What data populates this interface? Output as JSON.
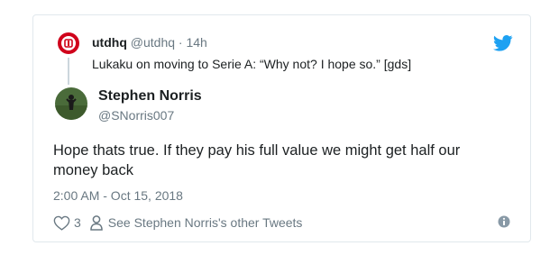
{
  "parent_tweet": {
    "name": "utdhq",
    "handle": "@utdhq",
    "separator": "·",
    "time": "14h",
    "text": "Lukaku on moving to Serie A: “Why not? I hope so.” [gds]"
  },
  "tweet": {
    "name": "Stephen Norris",
    "handle": "@SNorris007",
    "text": "Hope thats true. If they pay his full value we might get half our money back",
    "timestamp": "2:00 AM - Oct 15, 2018"
  },
  "actions": {
    "like_count": "3",
    "profile_link": "See Stephen Norris's other Tweets"
  },
  "icons": {
    "brand": "twitter-bird-icon",
    "like": "heart-icon",
    "profile": "person-icon",
    "info": "info-icon"
  },
  "colors": {
    "twitter_blue": "#1da1f2",
    "text": "#1c2022",
    "muted": "#697882",
    "border": "#e1e8ed",
    "utdhq_red": "#d0021b"
  }
}
